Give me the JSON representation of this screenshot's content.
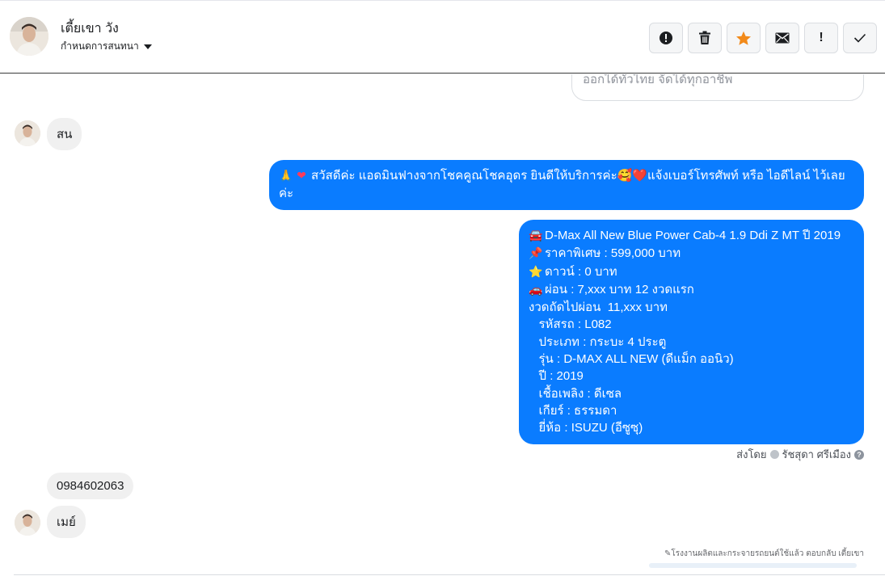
{
  "header": {
    "contact_name": "เตี้ยเขา วัง",
    "assign_label": "กำหนดการสนทนา"
  },
  "actions": [
    {
      "icon": "alert-circle-icon",
      "label": ""
    },
    {
      "icon": "trash-icon",
      "label": ""
    },
    {
      "icon": "star-icon",
      "label": ""
    },
    {
      "icon": "envelope-icon",
      "label": ""
    },
    {
      "icon": "exclamation-icon",
      "label": "!"
    },
    {
      "icon": "checkmark-icon",
      "label": ""
    }
  ],
  "colors": {
    "outgoing_bubble": "#0a7cff",
    "incoming_bubble": "#f0f0f0",
    "star": "#f28a1a"
  },
  "messages": {
    "previous_partial": "ออกได้ทั่วไทย จัดได้ทุกอาชีพ",
    "in_1": "สน",
    "out_1": {
      "emojis": [
        "🙏",
        "❤"
      ],
      "line1": "สวัสดีค่ะ แอดมินฟางจากโชคคูณโชคอุดร ยินดีให้บริการค่ะ🥰❤️แจ้งเบอร์โทรศัพท์ หรือ ไอดีไลน์  ไว้เลย",
      "line2": "ค่ะ"
    },
    "out_2": [
      {
        "emoji": "🚘",
        "text": "D-Max All New Blue Power Cab-4 1.9 Ddi Z MT ปี 2019"
      },
      {
        "emoji": "📌",
        "text": "ราคาพิเศษ : 599,000 บาท"
      },
      {
        "emoji": "⭐",
        "text": "ดาวน์ : 0 บาท"
      },
      {
        "emoji": "🚗",
        "text": "ผ่อน : 7,xxx บาท 12 งวดแรก"
      },
      {
        "emoji": "",
        "text": "งวดถัดไปผ่อน  11,xxx บาท"
      },
      {
        "emoji": "",
        "text": "   รหัสรถ : L082"
      },
      {
        "emoji": "",
        "text": "   ประเภท : กระบะ 4 ประตู"
      },
      {
        "emoji": "",
        "text": "   รุ่น : D-MAX ALL NEW (ดีแม็ก ออนิว)"
      },
      {
        "emoji": "",
        "text": "   ปี : 2019"
      },
      {
        "emoji": "",
        "text": "   เชื้อเพลิง : ดีเซล"
      },
      {
        "emoji": "",
        "text": "   เกียร์ : ธรรมดา"
      },
      {
        "emoji": "",
        "text": "   ยี่ห้อ : ISUZU (อีซูซุ)"
      }
    ],
    "sent_by_prefix": "ส่งโดย",
    "sent_by_name": "รัชสุดา ศรีเมือง",
    "in_2": "0984602063",
    "in_3": "เมย์",
    "footnote": "โรงงานผลิตและกระจายรถยนต์ใช้แล้ว ตอบกลับ เตี้ยเขา"
  }
}
